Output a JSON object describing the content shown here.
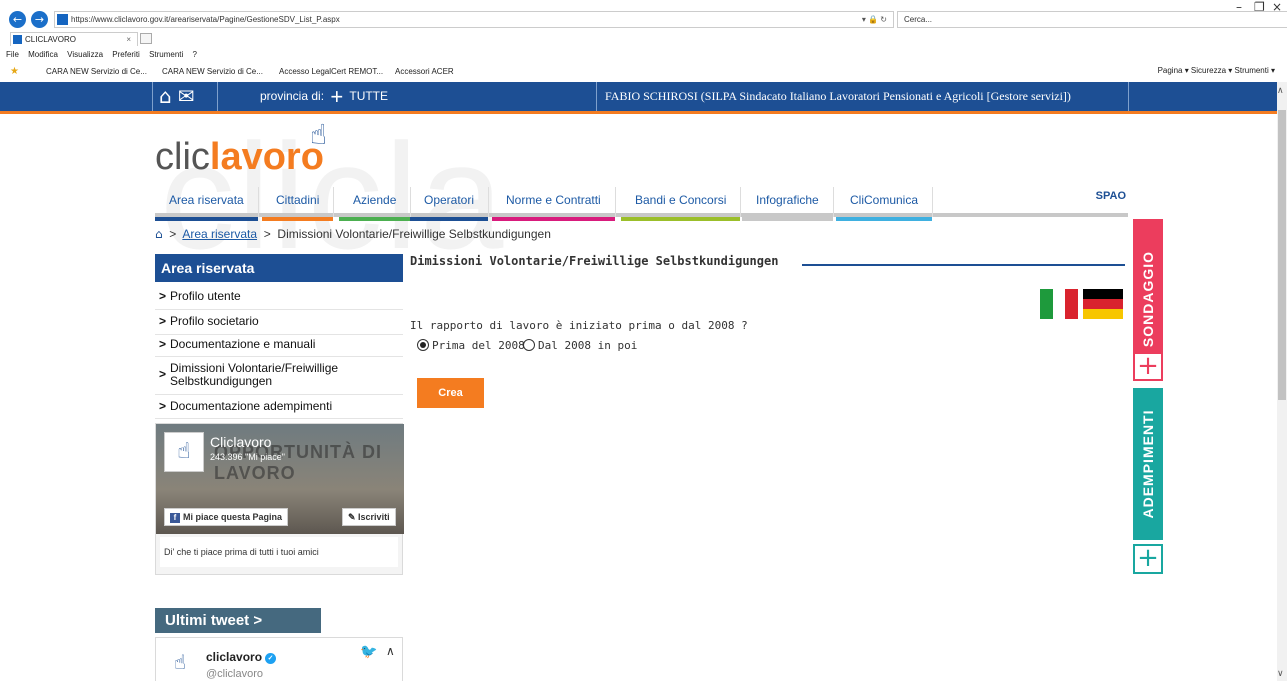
{
  "browser": {
    "url": "https://www.cliclavoro.gov.it/areariservata/Pagine/GestioneSDV_List_P.aspx",
    "search_placeholder": "Cerca...",
    "tab_title": "CLICLAVORO",
    "menu": [
      "File",
      "Modifica",
      "Visualizza",
      "Preferiti",
      "Strumenti",
      "?"
    ],
    "favorites": [
      "CARA NEW Servizio di Ce...",
      "CARA NEW Servizio di Ce...",
      "Accesso LegalCert REMOT...",
      "Accessori ACER"
    ],
    "commands": "Pagina ▾  Sicurezza ▾  Strumenti ▾"
  },
  "header": {
    "provincia_label": "provincia di:",
    "provincia_value": "TUTTE",
    "user": "FABIO SCHIROSI (SILPA Sindacato Italiano Lavoratori Pensionati e Agricoli [Gestore servizi])"
  },
  "logo": {
    "part1": "clic",
    "part2": "lavoro"
  },
  "watermark": "clicla",
  "nav": [
    {
      "label": "Area riservata",
      "color": "#1d4f94"
    },
    {
      "label": "Cittadini",
      "color": "#f47c20"
    },
    {
      "label": "Aziende",
      "color": "#4caf50"
    },
    {
      "label": "Operatori",
      "color": "#1d4f94"
    },
    {
      "label": "Norme e Contratti",
      "color": "#d81b7c"
    },
    {
      "label": "Bandi e Concorsi",
      "color": "#9bbf2a"
    },
    {
      "label": "Infografiche",
      "color": "#c8c8c8"
    },
    {
      "label": "CliComunica",
      "color": "#3fb0e0"
    }
  ],
  "nav_logo": "SPAO",
  "breadcrumb": {
    "link": "Area riservata",
    "current": "Dimissioni Volontarie/Freiwillige Selbstkundigungen"
  },
  "sidebar": {
    "title": "Area riservata",
    "items": [
      "Profilo utente",
      "Profilo societario",
      "Documentazione e manuali",
      "Dimissioni Volontarie/Freiwillige Selbstkundigungen",
      "Documentazione adempimenti"
    ]
  },
  "facebook": {
    "page_name": "Cliclavoro",
    "likes": "243.396 \"Mi piace\"",
    "image_text": "OPPORTUNITÀ DI LAVORO",
    "like_button": "Mi piace questa Pagina",
    "subscribe_button": "Iscriviti",
    "footer": "Di' che ti piace prima di tutti i tuoi amici"
  },
  "tweets": {
    "title": "Ultimi tweet >",
    "name": "cliclavoro",
    "handle": "@cliclavoro"
  },
  "main": {
    "title": "Dimissioni Volontarie/Freiwillige Selbstkundigungen",
    "question": "Il rapporto di lavoro è iniziato prima o dal 2008 ?",
    "options": [
      {
        "label": "Prima del 2008",
        "selected": true
      },
      {
        "label": "Dal 2008 in poi",
        "selected": false
      }
    ],
    "button": "Crea"
  },
  "side_tabs": {
    "sondaggio": "SONDAGGIO",
    "adempimenti": "ADEMPIMENTI"
  }
}
